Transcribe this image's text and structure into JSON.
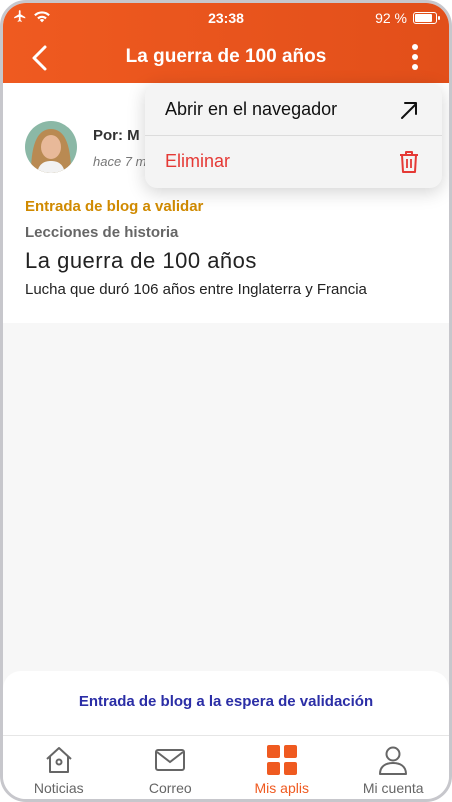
{
  "status_bar": {
    "time": "23:38",
    "battery_text": "92 %",
    "battery_level": 0.92,
    "icons": [
      "airplane-icon",
      "wifi-icon",
      "battery-icon"
    ]
  },
  "header": {
    "title": "La guerra de 100 años",
    "color": "#ef5a20"
  },
  "menu": {
    "items": [
      {
        "label": "Abrir en el navegador",
        "icon": "open-external-icon"
      },
      {
        "label": "Eliminar",
        "icon": "trash-icon",
        "color": "#e53935"
      }
    ]
  },
  "post": {
    "author": "Por: M",
    "time_ago": "hace 7 m",
    "status": "Entrada de blog a validar",
    "category": "Lecciones de historia",
    "title": "La guerra de 100 años",
    "summary": "Lucha que duró 106 años entre Inglaterra y Francia"
  },
  "notice": {
    "text": "Entrada de blog a la espera de validación"
  },
  "tabs": [
    {
      "label": "Noticias",
      "icon": "home-icon",
      "active": false
    },
    {
      "label": "Correo",
      "icon": "mail-icon",
      "active": false
    },
    {
      "label": "Mis aplis",
      "icon": "apps-grid-icon",
      "active": true
    },
    {
      "label": "Mi cuenta",
      "icon": "user-icon",
      "active": false
    }
  ]
}
